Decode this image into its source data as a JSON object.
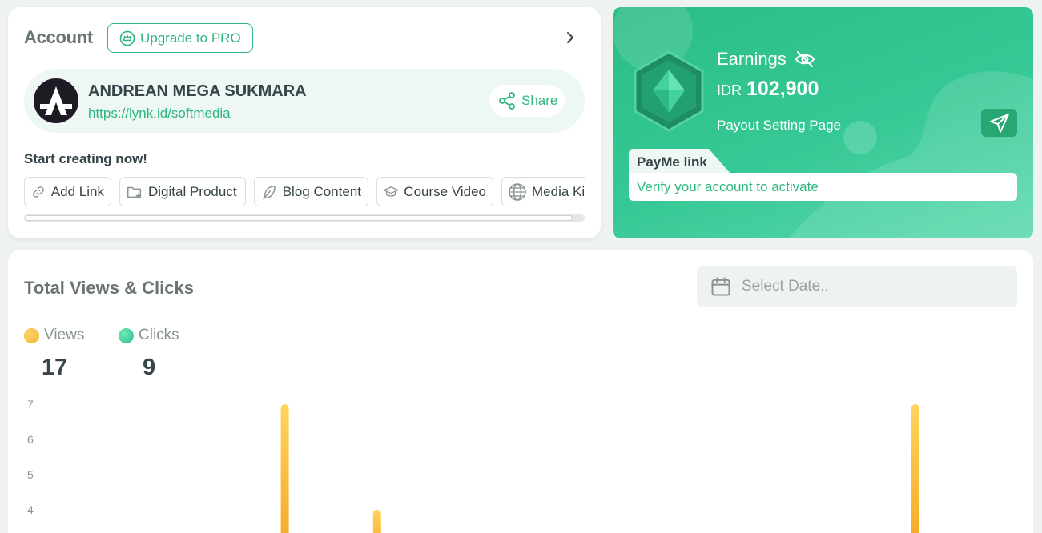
{
  "account": {
    "title": "Account",
    "upgrade_label": "Upgrade to PRO",
    "profile": {
      "name": "ANDREAN MEGA SUKMARA",
      "url": "https://lynk.id/softmedia",
      "share_label": "Share"
    },
    "start_creating": "Start creating now!",
    "create_buttons": [
      {
        "label": "Add Link",
        "icon": "link-icon"
      },
      {
        "label": "Digital Product",
        "icon": "folder-plus-icon"
      },
      {
        "label": "Blog Content",
        "icon": "feather-icon"
      },
      {
        "label": "Course Video",
        "icon": "graduation-cap-icon"
      },
      {
        "label": "Media Kit",
        "icon": "globe-icon"
      }
    ]
  },
  "earnings": {
    "label": "Earnings",
    "currency": "IDR",
    "amount": "102,900",
    "payout_label": "Payout Setting Page",
    "payme_tab": "PayMe link",
    "payme_message": "Verify your account to activate"
  },
  "views": {
    "title": "Total Views & Clicks",
    "date_placeholder": "Select Date..",
    "legend": [
      {
        "label": "Views",
        "value": "17",
        "color": "#f5b731"
      },
      {
        "label": "Clicks",
        "value": "9",
        "color": "#2fc48d"
      }
    ]
  },
  "colors": {
    "accent": "#2fb67f",
    "views": "#f5b731",
    "clicks": "#2fc48d"
  },
  "chart_data": {
    "type": "bar",
    "y_ticks": [
      4,
      5,
      6,
      7
    ],
    "ylim": [
      3,
      7
    ],
    "series": [
      {
        "color": "#f5b731",
        "points": [
          {
            "x": 0.27,
            "y": 7
          },
          {
            "x": 0.36,
            "y": 4
          },
          {
            "x": 0.885,
            "y": 7
          }
        ]
      }
    ]
  }
}
